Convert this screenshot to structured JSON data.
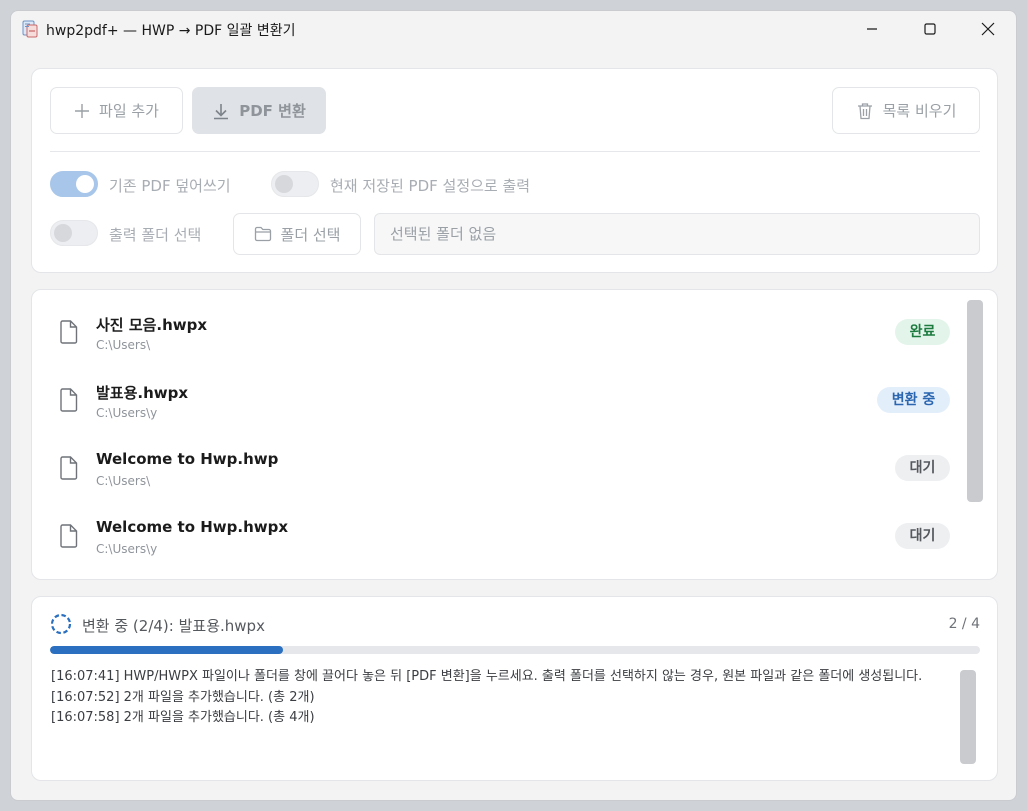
{
  "window": {
    "title": "hwp2pdf+ — HWP → PDF 일괄 변환기"
  },
  "toolbar": {
    "add_label": "파일 추가",
    "convert_label": "PDF 변환",
    "clear_label": "목록 비우기"
  },
  "options": {
    "overwrite_label": "기존 PDF 덮어쓰기",
    "overwrite_on": true,
    "use_current_label": "현재 저장된 PDF 설정으로 출력",
    "use_current_on": false,
    "output_folder_label": "출력 폴더 선택",
    "output_folder_on": false,
    "folder_button_label": "폴더 선택",
    "folder_path": "선택된 폴더 없음"
  },
  "files": [
    {
      "name": "사진 모음.hwpx",
      "path": "C:\\Users\\",
      "status": "완료",
      "status_type": "done"
    },
    {
      "name": "발표용.hwpx",
      "path": "C:\\Users\\y",
      "status": "변환 중",
      "status_type": "progress"
    },
    {
      "name": "Welcome to Hwp.hwp",
      "path": "C:\\Users\\",
      "status": "대기",
      "status_type": "waiting"
    },
    {
      "name": "Welcome to Hwp.hwpx",
      "path": "C:\\Users\\y",
      "status": "대기",
      "status_type": "waiting"
    }
  ],
  "progress": {
    "status_text": "변환 중 (2/4): 발표용.hwpx",
    "counter": "2 / 4",
    "fraction": 0.25
  },
  "log": {
    "lines": [
      "[16:07:41] HWP/HWPX 파일이나 폴더를 창에 끌어다 놓은 뒤 [PDF 변환]을 누르세요. 출력 폴더를 선택하지 않는 경우, 원본 파일과 같은 폴더에 생성됩니다.",
      "[16:07:52] 2개 파일을 추가했습니다. (총 2개)",
      "[16:07:58] 2개 파일을 추가했습니다. (총 4개)"
    ]
  },
  "colors": {
    "accent": "#2a6fc0",
    "done_badge": "#1c7a3f",
    "progress_badge": "#2a66b0"
  }
}
